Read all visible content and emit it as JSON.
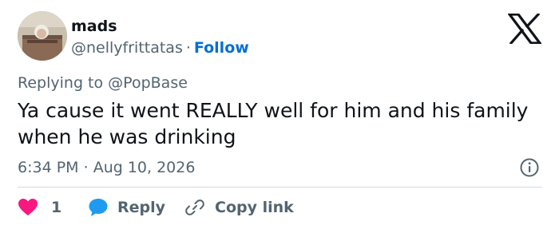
{
  "user": {
    "display_name": "mads",
    "handle": "@nellyfrittatas",
    "separator": "·",
    "follow_label": "Follow"
  },
  "tweet": {
    "replying_to_prefix": "Replying to",
    "replying_to_handle": "@PopBase",
    "text": "Ya cause it went REALLY well for him and his family when he was drinking",
    "time": "6:34 PM",
    "date_separator": "·",
    "date": "Aug 10, 2026"
  },
  "actions": {
    "like_count": "1",
    "reply_label": "Reply",
    "copy_link_label": "Copy link"
  },
  "colors": {
    "text_primary": "#0f1419",
    "text_secondary": "#536471",
    "link_blue": "#006fd6",
    "like_red": "#f91880",
    "reply_blue": "#1d9bf0",
    "divider": "#cfd9de"
  },
  "icons": {
    "brand": "x-logo-icon",
    "info": "info-icon",
    "like": "heart-icon",
    "reply": "speech-bubble-icon",
    "copy_link": "link-icon"
  }
}
